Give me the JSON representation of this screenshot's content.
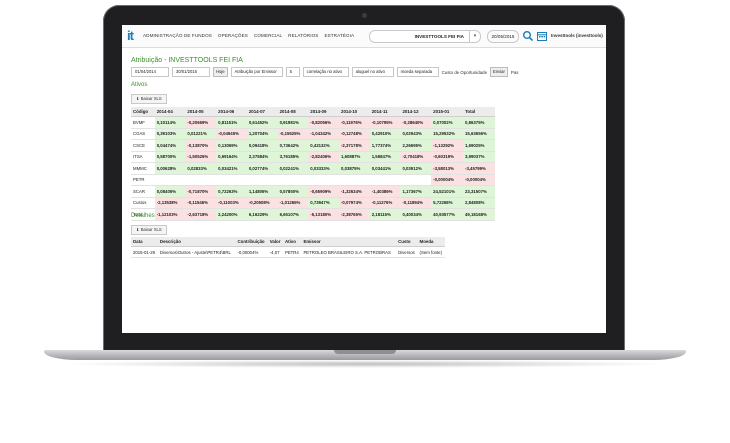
{
  "header": {
    "logo": "it",
    "nav": [
      "ADMINISTRAÇÃO DE FUNDOS",
      "OPERAÇÕES",
      "COMERCIAL",
      "RELATÓRIOS",
      "ESTRATÉGIA"
    ],
    "fund": "INVESTTOOLS FEI FIA",
    "date": "20/05/2015",
    "user": "Investtools (investtools)"
  },
  "page": {
    "title": "Atribuição - INVESTTOOLS FEI FIA"
  },
  "filters": {
    "start_date": "01/04/2014",
    "end_date": "30/01/2015",
    "today_button": "Hoje",
    "attribution": "Atribuição por Emissor",
    "number": "5",
    "ordering": "correlação no ativo",
    "rent": "aluguel no ativo",
    "currency": "moeda separada",
    "opportunity_label": "Custo de Oportunidade",
    "send_button": "Enviar",
    "tail": "Pas"
  },
  "ativos": {
    "title": "Ativos",
    "xls_button": "Baixar XLS",
    "columns": [
      "Código",
      "2014-04",
      "2014-05",
      "2014-06",
      "2014-07",
      "2014-08",
      "2014-09",
      "2014-10",
      "2014-11",
      "2014-12",
      "2015-01",
      "Total"
    ],
    "rows": [
      [
        "BVMF",
        "0,10114%",
        "-0,20669%",
        "0,81151%",
        "0,61452%",
        "0,91981%",
        "-0,82056%",
        "-0,11976%",
        "-0,10795%",
        "-0,28640%",
        "0,07002%",
        "0,86375%"
      ],
      [
        "CGAS",
        "0,39103%",
        "0,01221%",
        "-0,04945%",
        "1,20704%",
        "-0,15525%",
        "-1,04342%",
        "-0,12748%",
        "0,42910%",
        "0,02943%",
        "15,29532%",
        "15,63656%"
      ],
      [
        "CSCE",
        "0,04474%",
        "-0,13870%",
        "0,13069%",
        "0,09418%",
        "0,73642%",
        "0,43132%",
        "-2,37178%",
        "1,77374%",
        "2,26695%",
        "-1,13292%",
        "1,69025%"
      ],
      [
        "ITSA",
        "0,58700%",
        "-1,50526%",
        "0,69164%",
        "2,37584%",
        "3,76185%",
        "-2,82406%",
        "1,60887%",
        "1,56847%",
        "-2,70418%",
        "-0,60319%",
        "3,99037%"
      ],
      [
        "MMMC",
        "0,00628%",
        "0,02833%",
        "0,03421%",
        "0,02774%",
        "0,02241%",
        "0,03333%",
        "0,03875%",
        "0,03441%",
        "0,03912%",
        "-3,58013%",
        "-3,45799%"
      ],
      [
        "PETR",
        "",
        "",
        "",
        "",
        "",
        "",
        "",
        "",
        "",
        "-0,00004%",
        "-0,00004%"
      ],
      [
        "SCAR",
        "0,08405%",
        "-0,71870%",
        "0,72263%",
        "1,14806%",
        "0,57850%",
        "-0,65909%",
        "-1,32634%",
        "-1,40386%",
        "1,17367%",
        "24,52101%",
        "23,31507%"
      ],
      [
        "Custos",
        "-2,13538%",
        "-0,11546%",
        "-0,11003%",
        "-0,20508%",
        "-1,01265%",
        "0,73947%",
        "-0,07974%",
        "-0,11276%",
        "-0,11894%",
        "5,72268%",
        "2,84808%"
      ],
      [
        "Total",
        "-1,12103%",
        "-2,63718%",
        "2,24200%",
        "6,16229%",
        "6,65107%",
        "-5,13180%",
        "-2,38765%",
        "2,18115%",
        "0,40034%",
        "40,93577%",
        "49,18168%"
      ]
    ]
  },
  "detalhes": {
    "title": "Detalhes",
    "xls_button": "Baixar XLS",
    "columns": [
      "Data",
      "Descrição",
      "Contribuição",
      "Valor",
      "Ativo",
      "Emissor",
      "Custo",
      "Moeda"
    ],
    "rows": [
      [
        "2015-01-29",
        "Diversos\\Outros - Ajuste\\PETR4\\BRL",
        "-0,00004%",
        "-4,07",
        "PETR4",
        "PETROLEO BRASILEIRO S.A. PETROBRAS",
        "Diversos",
        "(Sem fonte)"
      ]
    ]
  },
  "colors": {
    "accent": "#3d8f2e",
    "positive": "#1c8a1c",
    "negative": "#e00000",
    "link_blue": "#1a7fb8"
  }
}
